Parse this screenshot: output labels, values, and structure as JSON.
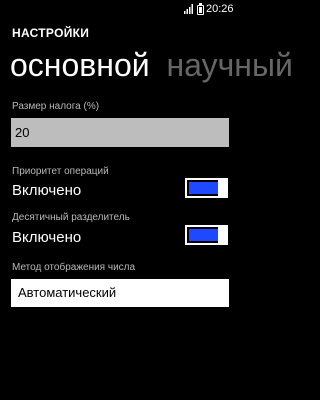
{
  "status_bar": {
    "time": "20:26",
    "icons": [
      "signal-icon",
      "battery-icon"
    ]
  },
  "header": {
    "title": "НАСТРОЙКИ"
  },
  "pivot": {
    "tabs": [
      {
        "label": "основной",
        "active": true
      },
      {
        "label": "научный",
        "active": false
      }
    ]
  },
  "settings": {
    "tax_size": {
      "label": "Размер налога (%)",
      "value": "20"
    },
    "operation_priority": {
      "label": "Приоритет операций",
      "state": "Включено",
      "enabled": true
    },
    "decimal_separator": {
      "label": "Десятичный разделитель",
      "state": "Включено",
      "enabled": true
    },
    "number_display_method": {
      "label": "Метод отображения числа",
      "value": "Автоматический"
    }
  },
  "colors": {
    "background": "#000000",
    "accent": "#1f49ff",
    "textbox_bg": "#bdbdbd"
  }
}
